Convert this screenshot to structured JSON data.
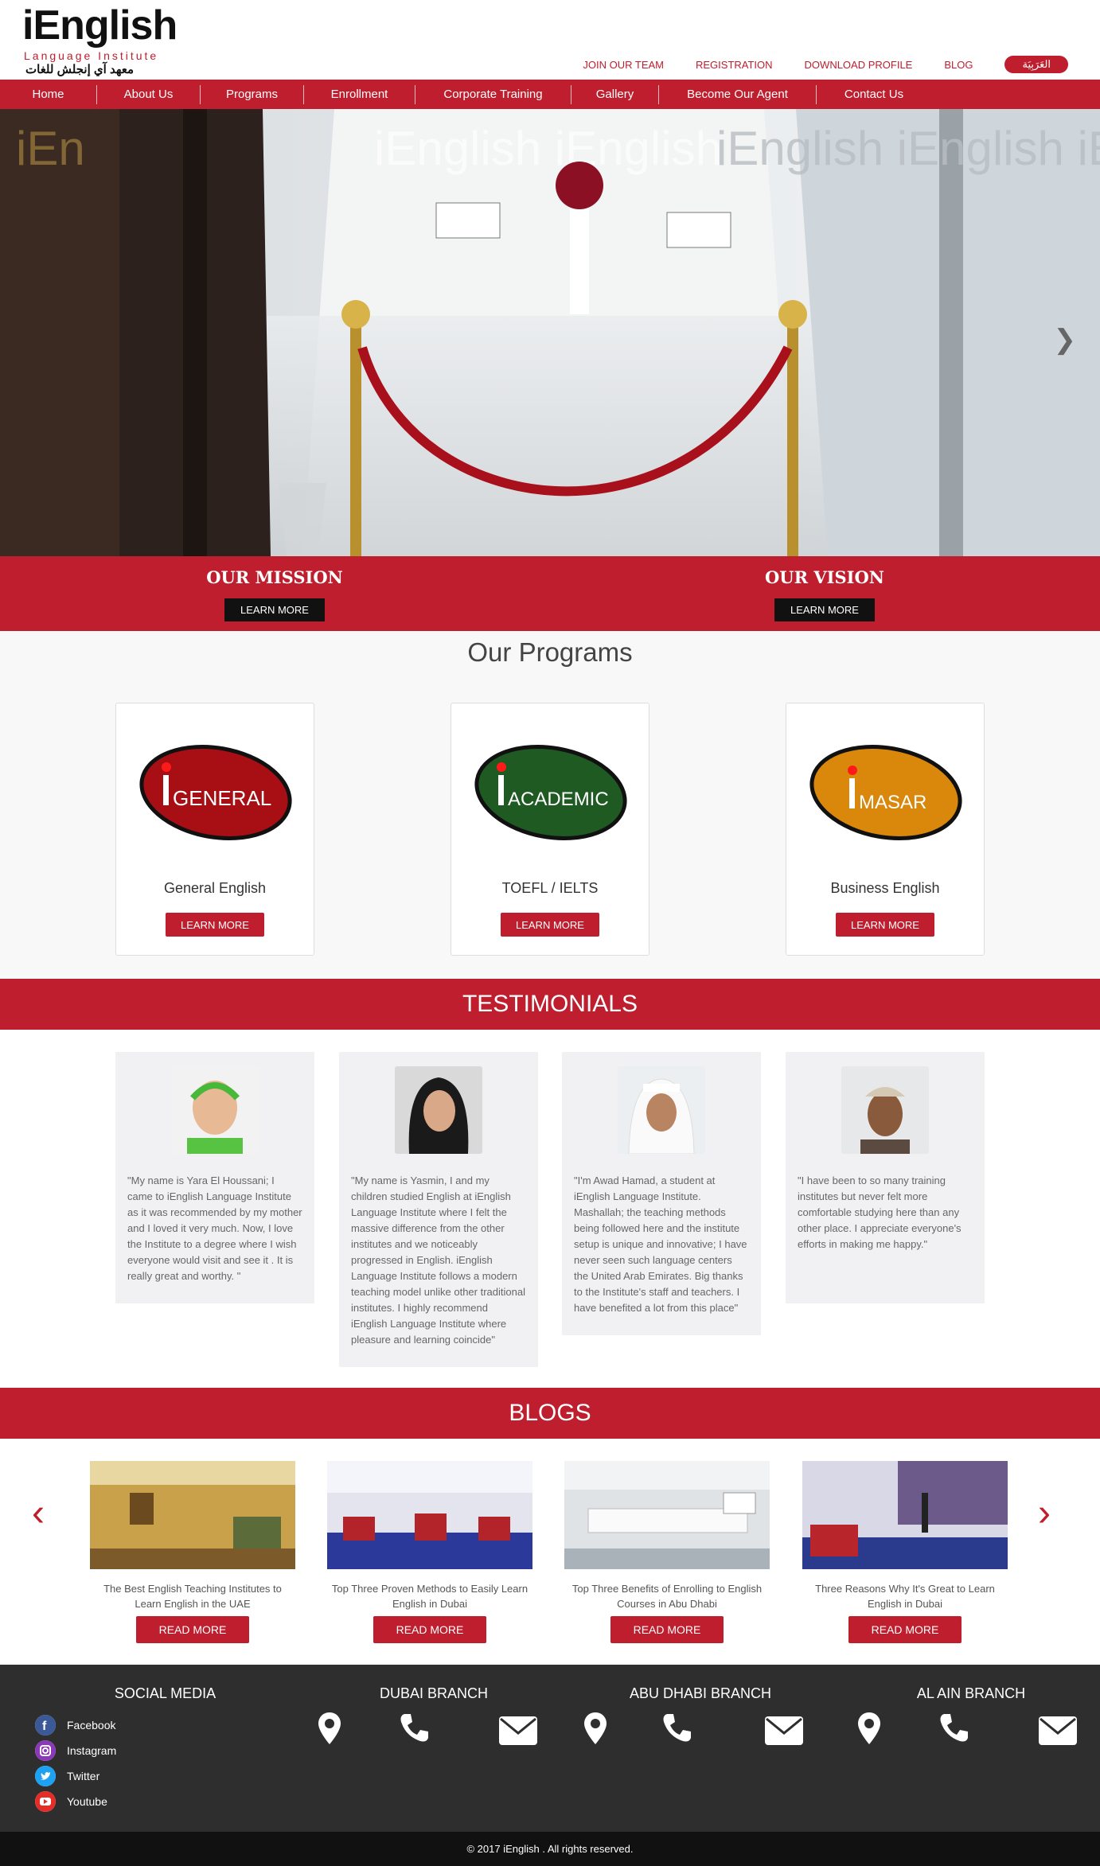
{
  "header": {
    "logo_brand": "iEnglish",
    "logo_sub": "Language Institute",
    "logo_arabic": "معهد آي إنجلش للغات",
    "top_links": [
      "JOIN OUR TEAM",
      "REGISTRATION",
      "DOWNLOAD PROFILE",
      "BLOG"
    ],
    "arabic_button": "العَرَبِيَة"
  },
  "nav": [
    "Home",
    "About Us",
    "Programs",
    "Enrollment",
    "Corporate Training",
    "Gallery",
    "Become Our Agent",
    "Contact Us"
  ],
  "hero": {
    "next_arrow": "❯"
  },
  "mission": {
    "title": "OUR MISSION",
    "button": "LEARN MORE"
  },
  "vision": {
    "title": "OUR VISION",
    "button": "LEARN MORE"
  },
  "programs": {
    "heading": "Our Programs",
    "items": [
      {
        "logo": "GENERAL",
        "name": "General English",
        "button": "LEARN MORE",
        "color": "#a80f14"
      },
      {
        "logo": "ACADEMIC",
        "name": "TOEFL / IELTS",
        "button": "LEARN MORE",
        "color": "#1f5a23"
      },
      {
        "logo": "MASAR",
        "name": "Business English",
        "button": "LEARN MORE",
        "color": "#d9880c"
      }
    ]
  },
  "testimonials": {
    "heading": "TESTIMONIALS",
    "items": [
      {
        "text": "\"My name is Yara El Houssani; I came to iEnglish Language Institute as it was recommended by my mother and I loved it very much. Now, I love the Institute to a degree where I wish everyone would visit and see it . It is really great and worthy. \""
      },
      {
        "text": "\"My name is Yasmin, I and my children studied English at iEnglish Language Institute where I felt the massive difference from the other institutes and we noticeably progressed in English. iEnglish Language Institute follows a modern teaching model unlike other traditional institutes. I highly recommend iEnglish Language Institute where pleasure and learning coincide\""
      },
      {
        "text": "\"I'm Awad Hamad, a student at iEnglish Language Institute. Mashallah; the teaching methods being followed here and the institute setup is unique and innovative; I have never seen such language centers the United Arab Emirates. Big thanks to the Institute's staff and teachers. I have benefited a lot from this place\""
      },
      {
        "text": "\"I have been to so many training institutes but never felt more comfortable studying here than any other place. I appreciate everyone's efforts in making me happy.\""
      }
    ]
  },
  "blogs": {
    "heading": "BLOGS",
    "prev": "‹",
    "next": "›",
    "items": [
      {
        "title": "The Best English Teaching Institutes to Learn English in the UAE",
        "button": "READ MORE"
      },
      {
        "title": "Top Three Proven Methods to Easily Learn English in Dubai",
        "button": "READ MORE"
      },
      {
        "title": "Top Three Benefits of Enrolling to English Courses in Abu Dhabi",
        "button": "READ MORE"
      },
      {
        "title": "Three Reasons Why It's Great to Learn English in Dubai",
        "button": "READ MORE"
      }
    ]
  },
  "footer": {
    "social_heading": "SOCIAL MEDIA",
    "social": [
      {
        "label": "Facebook",
        "icon": "facebook-icon",
        "color": "#3b5998"
      },
      {
        "label": "Instagram",
        "icon": "instagram-icon",
        "color": "#8a3ab9"
      },
      {
        "label": "Twitter",
        "icon": "twitter-icon",
        "color": "#1da1f2"
      },
      {
        "label": "Youtube",
        "icon": "youtube-icon",
        "color": "#e52d27"
      }
    ],
    "branches": [
      "DUBAI BRANCH",
      "ABU DHABI BRANCH",
      "AL AIN BRANCH"
    ],
    "copyright": "© 2017 iEnglish . All rights reserved."
  },
  "colors": {
    "accent": "#be1e2d",
    "footer": "#2e2e2e"
  }
}
